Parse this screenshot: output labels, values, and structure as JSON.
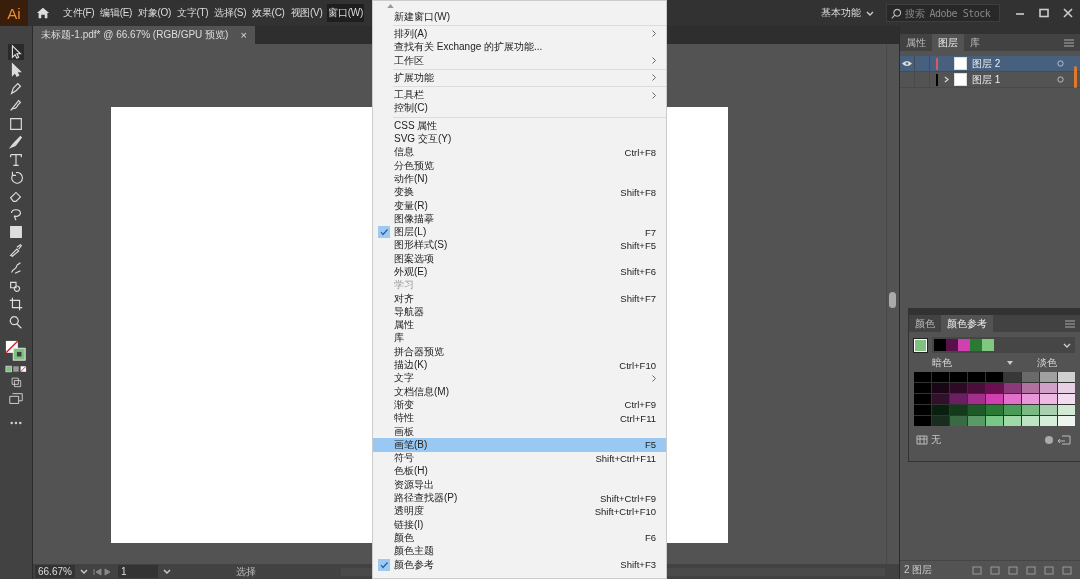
{
  "app": {
    "logo": "Ai"
  },
  "menubar": [
    {
      "label": "文件(F)",
      "selected": false
    },
    {
      "label": "编辑(E)",
      "selected": false
    },
    {
      "label": "对象(O)",
      "selected": false
    },
    {
      "label": "文字(T)",
      "selected": false
    },
    {
      "label": "选择(S)",
      "selected": false
    },
    {
      "label": "效果(C)",
      "selected": false
    },
    {
      "label": "视图(V)",
      "selected": false
    },
    {
      "label": "窗口(W)",
      "selected": true
    }
  ],
  "workspace": {
    "label": "基本功能"
  },
  "search": {
    "placeholder": "搜索 Adobe Stock"
  },
  "document_tab": {
    "title": "未标题-1.pdf* @ 66.67% (RGB/GPU 预览)",
    "close": "×"
  },
  "window_menu": {
    "groups": [
      [
        {
          "label": "新建窗口(W)",
          "submenu": false,
          "checked": false,
          "disabled": false,
          "selected": false
        }
      ],
      [
        {
          "label": "排列(A)",
          "submenu": true,
          "checked": false,
          "disabled": false,
          "selected": false
        },
        {
          "label": "查找有关 Exchange 的扩展功能...",
          "submenu": false,
          "checked": false,
          "disabled": false,
          "selected": false
        },
        {
          "label": "工作区",
          "submenu": true,
          "checked": false,
          "disabled": false,
          "selected": false
        }
      ],
      [
        {
          "label": "扩展功能",
          "submenu": true,
          "checked": false,
          "disabled": false,
          "selected": false
        }
      ],
      [
        {
          "label": "工具栏",
          "submenu": true,
          "checked": false,
          "disabled": false,
          "selected": false
        },
        {
          "label": "控制(C)",
          "submenu": false,
          "checked": false,
          "disabled": false,
          "selected": false
        }
      ],
      [
        {
          "label": "CSS 属性",
          "submenu": false,
          "checked": false,
          "disabled": false,
          "selected": false
        },
        {
          "label": "SVG 交互(Y)",
          "submenu": false,
          "checked": false,
          "disabled": false,
          "selected": false
        },
        {
          "label": "信息",
          "shortcut": "Ctrl+F8",
          "submenu": false,
          "checked": false,
          "disabled": false,
          "selected": false
        },
        {
          "label": "分色预览",
          "submenu": false,
          "checked": false,
          "disabled": false,
          "selected": false
        },
        {
          "label": "动作(N)",
          "submenu": false,
          "checked": false,
          "disabled": false,
          "selected": false
        },
        {
          "label": "变换",
          "shortcut": "Shift+F8",
          "submenu": false,
          "checked": false,
          "disabled": false,
          "selected": false
        },
        {
          "label": "变量(R)",
          "submenu": false,
          "checked": false,
          "disabled": false,
          "selected": false
        },
        {
          "label": "图像描摹",
          "submenu": false,
          "checked": false,
          "disabled": false,
          "selected": false
        },
        {
          "label": "图层(L)",
          "shortcut": "F7",
          "submenu": false,
          "checked": true,
          "disabled": false,
          "selected": false
        },
        {
          "label": "图形样式(S)",
          "shortcut": "Shift+F5",
          "submenu": false,
          "checked": false,
          "disabled": false,
          "selected": false
        },
        {
          "label": "图案选项",
          "submenu": false,
          "checked": false,
          "disabled": false,
          "selected": false
        },
        {
          "label": "外观(E)",
          "shortcut": "Shift+F6",
          "submenu": false,
          "checked": false,
          "disabled": false,
          "selected": false
        },
        {
          "label": "学习",
          "submenu": false,
          "checked": false,
          "disabled": true,
          "selected": false
        },
        {
          "label": "对齐",
          "shortcut": "Shift+F7",
          "submenu": false,
          "checked": false,
          "disabled": false,
          "selected": false
        },
        {
          "label": "导航器",
          "submenu": false,
          "checked": false,
          "disabled": false,
          "selected": false
        },
        {
          "label": "属性",
          "submenu": false,
          "checked": false,
          "disabled": false,
          "selected": false
        },
        {
          "label": "库",
          "submenu": false,
          "checked": false,
          "disabled": false,
          "selected": false
        },
        {
          "label": "拼合器预览",
          "submenu": false,
          "checked": false,
          "disabled": false,
          "selected": false
        },
        {
          "label": "描边(K)",
          "shortcut": "Ctrl+F10",
          "submenu": false,
          "checked": false,
          "disabled": false,
          "selected": false
        },
        {
          "label": "文字",
          "submenu": true,
          "checked": false,
          "disabled": false,
          "selected": false
        },
        {
          "label": "文档信息(M)",
          "submenu": false,
          "checked": false,
          "disabled": false,
          "selected": false
        },
        {
          "label": "渐变",
          "shortcut": "Ctrl+F9",
          "submenu": false,
          "checked": false,
          "disabled": false,
          "selected": false
        },
        {
          "label": "特性",
          "shortcut": "Ctrl+F11",
          "submenu": false,
          "checked": false,
          "disabled": false,
          "selected": false
        },
        {
          "label": "画板",
          "submenu": false,
          "checked": false,
          "disabled": false,
          "selected": false
        },
        {
          "label": "画笔(B)",
          "shortcut": "F5",
          "submenu": false,
          "checked": false,
          "disabled": false,
          "selected": true
        },
        {
          "label": "符号",
          "shortcut": "Shift+Ctrl+F11",
          "submenu": false,
          "checked": false,
          "disabled": false,
          "selected": false
        },
        {
          "label": "色板(H)",
          "submenu": false,
          "checked": false,
          "disabled": false,
          "selected": false
        },
        {
          "label": "资源导出",
          "submenu": false,
          "checked": false,
          "disabled": false,
          "selected": false
        },
        {
          "label": "路径查找器(P)",
          "shortcut": "Shift+Ctrl+F9",
          "submenu": false,
          "checked": false,
          "disabled": false,
          "selected": false
        },
        {
          "label": "透明度",
          "shortcut": "Shift+Ctrl+F10",
          "submenu": false,
          "checked": false,
          "disabled": false,
          "selected": false
        },
        {
          "label": "链接(I)",
          "submenu": false,
          "checked": false,
          "disabled": false,
          "selected": false
        },
        {
          "label": "颜色",
          "shortcut": "F6",
          "submenu": false,
          "checked": false,
          "disabled": false,
          "selected": false
        },
        {
          "label": "颜色主题",
          "submenu": false,
          "checked": false,
          "disabled": false,
          "selected": false
        },
        {
          "label": "颜色参考",
          "shortcut": "Shift+F3",
          "submenu": false,
          "checked": true,
          "disabled": false,
          "selected": false
        }
      ]
    ]
  },
  "layers_panel": {
    "tabs": [
      {
        "label": "属性",
        "selected": false
      },
      {
        "label": "图层",
        "selected": true
      },
      {
        "label": "库",
        "selected": false
      }
    ],
    "layers": [
      {
        "name": "图层 2",
        "visible": true,
        "selected": true,
        "expandable": false,
        "color": "#d85a5a"
      },
      {
        "name": "图层 1",
        "visible": false,
        "selected": false,
        "expandable": true,
        "color": "#000000"
      }
    ],
    "footer": "2 图层"
  },
  "color_guide": {
    "tabs": [
      {
        "label": "颜色",
        "selected": false
      },
      {
        "label": "颜色参考",
        "selected": true
      }
    ],
    "base": {
      "color": "#80c080"
    },
    "harmony": [
      {
        "color": "#000000"
      },
      {
        "color": "#5a1048"
      },
      {
        "color": "#d040b0"
      },
      {
        "color": "#2a7a36"
      },
      {
        "color": "#80c880"
      }
    ],
    "dark_label": "暗色",
    "light_label": "淡色",
    "grid": [
      [
        {
          "color": "#000000"
        },
        {
          "color": "#000000"
        },
        {
          "color": "#000000"
        },
        {
          "color": "#000000"
        },
        {
          "color": "#000000"
        },
        {
          "color": "#383838"
        },
        {
          "color": "#6a6a6a"
        },
        {
          "color": "#a0a0a0"
        },
        {
          "color": "#d0d0d0"
        }
      ],
      [
        {
          "color": "#000000"
        },
        {
          "color": "#1a0614"
        },
        {
          "color": "#2e0a24"
        },
        {
          "color": "#4a0e3a"
        },
        {
          "color": "#6a1050"
        },
        {
          "color": "#8a3a78"
        },
        {
          "color": "#b070a0"
        },
        {
          "color": "#d0a0c8"
        },
        {
          "color": "#e8d0e4"
        }
      ],
      [
        {
          "color": "#000000"
        },
        {
          "color": "#30102a"
        },
        {
          "color": "#6a2060"
        },
        {
          "color": "#a0308a"
        },
        {
          "color": "#d040b0"
        },
        {
          "color": "#e070c8"
        },
        {
          "color": "#e898d8"
        },
        {
          "color": "#f0b8e4"
        },
        {
          "color": "#f4dcf0"
        }
      ],
      [
        {
          "color": "#000000"
        },
        {
          "color": "#0a200e"
        },
        {
          "color": "#143a1a"
        },
        {
          "color": "#1e5a28"
        },
        {
          "color": "#2a7a36"
        },
        {
          "color": "#4a9a58"
        },
        {
          "color": "#7ab884"
        },
        {
          "color": "#a8d0ae"
        },
        {
          "color": "#d4e8d6"
        }
      ],
      [
        {
          "color": "#000000"
        },
        {
          "color": "#1a2c1e"
        },
        {
          "color": "#3a6a44"
        },
        {
          "color": "#5a9a66"
        },
        {
          "color": "#7ac888"
        },
        {
          "color": "#a0d8a8"
        },
        {
          "color": "#bce4c2"
        },
        {
          "color": "#d4eed8"
        },
        {
          "color": "#ecf6ee"
        }
      ]
    ],
    "footer_label": "无"
  },
  "status_bar": {
    "zoom": "66.67%",
    "page": "1",
    "tool": "选择"
  }
}
